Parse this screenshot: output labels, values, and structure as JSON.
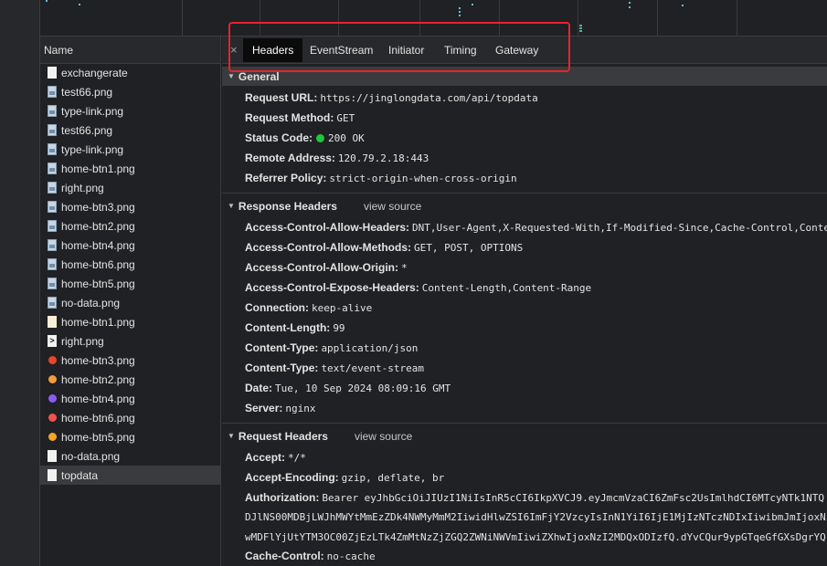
{
  "name_column": {
    "header": "Name",
    "files": [
      {
        "name": "exchangerate",
        "icon": "document-icon"
      },
      {
        "name": "test66.png",
        "icon": "image-icon"
      },
      {
        "name": "type-link.png",
        "icon": "image-icon"
      },
      {
        "name": "test66.png",
        "icon": "image-icon"
      },
      {
        "name": "type-link.png",
        "icon": "image-icon"
      },
      {
        "name": "home-btn1.png",
        "icon": "image-icon"
      },
      {
        "name": "right.png",
        "icon": "image-icon"
      },
      {
        "name": "home-btn3.png",
        "icon": "image-icon"
      },
      {
        "name": "home-btn2.png",
        "icon": "image-icon"
      },
      {
        "name": "home-btn4.png",
        "icon": "image-icon"
      },
      {
        "name": "home-btn6.png",
        "icon": "image-icon"
      },
      {
        "name": "home-btn5.png",
        "icon": "image-icon"
      },
      {
        "name": "no-data.png",
        "icon": "image-icon"
      },
      {
        "name": "home-btn1.png",
        "icon": "cream-image-icon"
      },
      {
        "name": "right.png",
        "icon": "arrow-image-icon"
      },
      {
        "name": "home-btn3.png",
        "icon": "red-dot-icon",
        "color": "#e8452c"
      },
      {
        "name": "home-btn2.png",
        "icon": "orange-dot-icon",
        "color": "#f29d38"
      },
      {
        "name": "home-btn4.png",
        "icon": "purple-dot-icon",
        "color": "#8a5cf5"
      },
      {
        "name": "home-btn6.png",
        "icon": "red-dot-icon",
        "color": "#ef5350"
      },
      {
        "name": "home-btn5.png",
        "icon": "orange-dot-icon",
        "color": "#f5a524"
      },
      {
        "name": "no-data.png",
        "icon": "document-icon"
      },
      {
        "name": "topdata",
        "icon": "document-icon",
        "selected": true
      }
    ]
  },
  "tabs": {
    "close": "×",
    "items": [
      "Headers",
      "EventStream",
      "Initiator",
      "Timing",
      "Gateway"
    ],
    "active": "Headers"
  },
  "general": {
    "title": "General",
    "rows": [
      {
        "key": "Request URL:",
        "value": "https://jinglongdata.com/api/topdata"
      },
      {
        "key": "Request Method:",
        "value": "GET"
      },
      {
        "key": "Status Code:",
        "value": "200 OK"
      },
      {
        "key": "Remote Address:",
        "value": "120.79.2.18:443"
      },
      {
        "key": "Referrer Policy:",
        "value": "strict-origin-when-cross-origin"
      }
    ]
  },
  "response_headers": {
    "title": "Response Headers",
    "view_source": "view source",
    "rows": [
      {
        "key": "Access-Control-Allow-Headers:",
        "value": "DNT,User-Agent,X-Requested-With,If-Modified-Since,Cache-Control,Conte"
      },
      {
        "key": "Access-Control-Allow-Methods:",
        "value": "GET, POST, OPTIONS"
      },
      {
        "key": "Access-Control-Allow-Origin:",
        "value": "*"
      },
      {
        "key": "Access-Control-Expose-Headers:",
        "value": "Content-Length,Content-Range"
      },
      {
        "key": "Connection:",
        "value": "keep-alive"
      },
      {
        "key": "Content-Length:",
        "value": "99"
      },
      {
        "key": "Content-Type:",
        "value": "application/json"
      },
      {
        "key": "Content-Type:",
        "value": "text/event-stream"
      },
      {
        "key": "Date:",
        "value": "Tue, 10 Sep 2024 08:09:16 GMT"
      },
      {
        "key": "Server:",
        "value": "nginx"
      }
    ]
  },
  "request_headers": {
    "title": "Request Headers",
    "view_source": "view source",
    "rows": [
      {
        "key": "Accept:",
        "value": "*/*"
      },
      {
        "key": "Accept-Encoding:",
        "value": "gzip, deflate, br"
      },
      {
        "key": "Authorization:",
        "value": "Bearer eyJhbGciOiJIUzI1NiIsInR5cCI6IkpXVCJ9.eyJmcmVzaCI6ZmFsc2UsImlhdCI6MTcyNTk1NTQ"
      }
    ],
    "authorization_continued": [
      "DJlNS00MDBjLWJhMWYtMmEzZDk4NWMyMmM2IiwidHlwZSI6ImFjY2VzcyIsInN1YiI6IjE1MjIzNTczNDIxIiwibmJmIjoxNz",
      "wMDFlYjUtYTM3OC00ZjEzLTk4ZmMtNzZjZGQ2ZWNiNWVmIiwiZXhwIjoxNzI2MDQxODIzfQ.dYvCQur9ypGTqeGfGXsDgrYQ"
    ],
    "rows_after": [
      {
        "key": "Cache-Control:",
        "value": "no-cache"
      }
    ]
  },
  "colors": {
    "status_ok": "#1ec63c",
    "highlight_box": "#e8222d"
  }
}
